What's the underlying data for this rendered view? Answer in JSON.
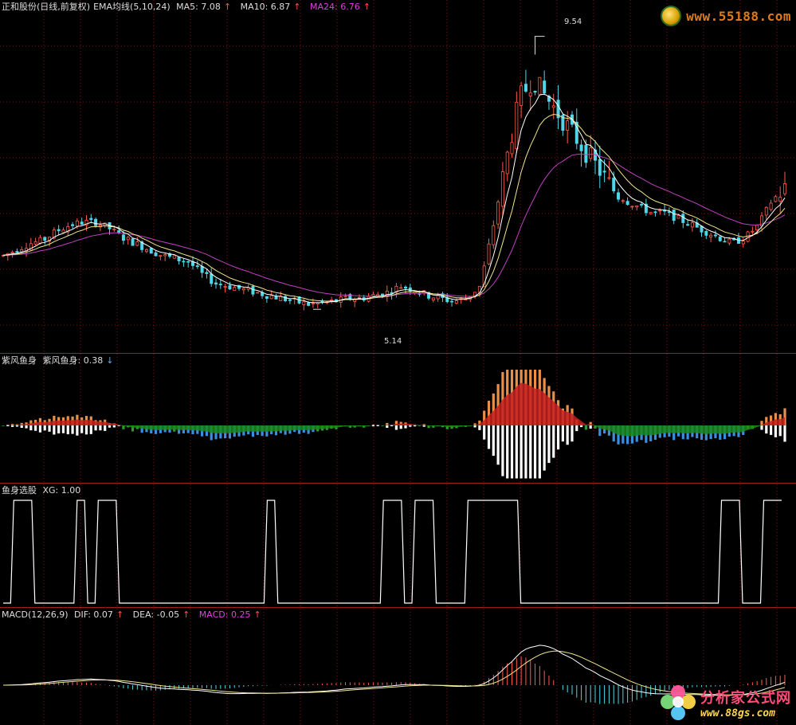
{
  "panels": {
    "main": {
      "name": "正和股份(日线,前复权)",
      "indicator": "EMA均线(5,10,24)",
      "items": [
        {
          "label": "MA5: 7.08",
          "color": "#ffffff",
          "arrow": "↑"
        },
        {
          "label": "MA10: 6.87",
          "color": "#ffffff",
          "arrow": "↑"
        },
        {
          "label": "MA24: 6.76",
          "color": "#e040e0",
          "arrow": "↑"
        }
      ],
      "high_label": "9.54",
      "low_label": "5.14"
    },
    "fish": {
      "name": "紫风鱼身",
      "items": [
        {
          "label": "紫风鱼身: 0.38",
          "color": "#ffffff",
          "arrow": "↓"
        }
      ]
    },
    "xg": {
      "name": "鱼身选股",
      "items": [
        {
          "label": "XG: 1.00",
          "color": "#ffffff",
          "arrow": ""
        }
      ]
    },
    "macd": {
      "name": "MACD(12,26,9)",
      "items": [
        {
          "label": "DIF: 0.07",
          "color": "#ffffff",
          "arrow": "↑"
        },
        {
          "label": "DEA: -0.05",
          "color": "#ffffff",
          "arrow": "↑"
        },
        {
          "label": "MACD: 0.25",
          "color": "#e040e0",
          "arrow": "↑"
        }
      ]
    }
  },
  "watermarks": {
    "top": "www.55188.com",
    "bottom_title": "分析家公式网",
    "bottom_url": "www.88gs.com"
  },
  "chart_data": {
    "type": "candlestick",
    "price_range": [
      5.0,
      10.0
    ],
    "ma_colors": {
      "MA5": "#ffffff",
      "MA10": "#f0e68c",
      "MA24": "#c040c0"
    },
    "up_color": "#ff5a4a",
    "down_color": "#4fd6e8",
    "close_path": [
      6.0,
      6.1,
      6.2,
      6.25,
      6.4,
      6.5,
      6.55,
      6.55,
      6.45,
      6.3,
      6.2,
      6.1,
      6.0,
      5.95,
      5.9,
      5.7,
      5.55,
      5.5,
      5.45,
      5.4,
      5.35,
      5.3,
      5.25,
      5.2,
      5.22,
      5.25,
      5.3,
      5.3,
      5.35,
      5.4,
      5.5,
      5.45,
      5.35,
      5.3,
      5.25,
      5.3,
      5.5,
      6.5,
      7.6,
      8.6,
      8.9,
      8.6,
      8.3,
      8.0,
      7.7,
      7.4,
      7.1,
      6.9,
      6.8,
      6.7,
      6.7,
      6.6,
      6.5,
      6.4,
      6.3,
      6.2,
      6.3,
      6.5,
      6.9,
      7.1
    ],
    "high_label": 9.54,
    "low_label": 5.14,
    "xg_signal": [
      0,
      1,
      1,
      0,
      0,
      0,
      0,
      1,
      0,
      1,
      1,
      0,
      0,
      0,
      0,
      0,
      0,
      0,
      0,
      0,
      0,
      0,
      0,
      0,
      0,
      1,
      0,
      0,
      0,
      0,
      0,
      0,
      0,
      0,
      0,
      0,
      1,
      1,
      0,
      1,
      1,
      0,
      0,
      0,
      1,
      1,
      1,
      1,
      1,
      0,
      0,
      0,
      0,
      0,
      0,
      0,
      0,
      0,
      0,
      0,
      0,
      0,
      0,
      0,
      0,
      0,
      0,
      0,
      1,
      1,
      0,
      0,
      1,
      1
    ],
    "series": [
      {
        "name": "MA5",
        "last": 7.08
      },
      {
        "name": "MA10",
        "last": 6.87
      },
      {
        "name": "MA24",
        "last": 6.76
      },
      {
        "name": "紫风鱼身",
        "last": 0.38
      },
      {
        "name": "XG",
        "last": 1.0
      },
      {
        "name": "DIF",
        "last": 0.07
      },
      {
        "name": "DEA",
        "last": -0.05
      },
      {
        "name": "MACD",
        "last": 0.25
      }
    ]
  }
}
